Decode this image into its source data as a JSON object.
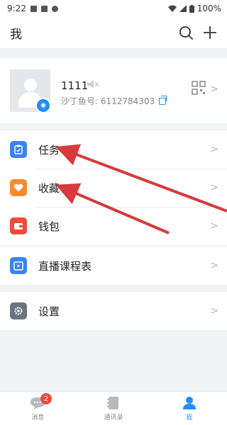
{
  "status_bar": {
    "time": "9:22",
    "battery": "100%"
  },
  "header": {
    "title": "我"
  },
  "profile": {
    "name": "1111",
    "id_label": "沙丁鱼号: 6112784303"
  },
  "menu_group1": [
    {
      "label": "任务",
      "color": "#3b82f6",
      "icon": "clipboard-icon"
    },
    {
      "label": "收藏",
      "color": "#ff8a2a",
      "icon": "heart-icon"
    },
    {
      "label": "钱包",
      "color": "#ef4c3c",
      "icon": "wallet-icon"
    }
  ],
  "menu_group2": [
    {
      "label": "直播课程表",
      "color": "#3b82f6",
      "icon": "calendar-play-icon"
    }
  ],
  "menu_group3": [
    {
      "label": "设置",
      "color": "#6b7280",
      "icon": "gear-icon"
    }
  ],
  "tabbar": {
    "tabs": [
      {
        "label": "消息",
        "badge": "2"
      },
      {
        "label": "通讯录"
      },
      {
        "label": "我"
      }
    ]
  }
}
